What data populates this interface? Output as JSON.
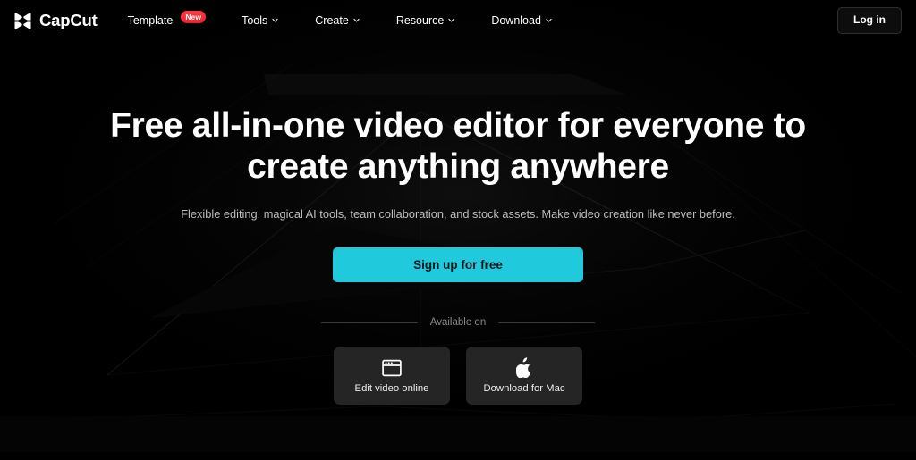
{
  "header": {
    "brand": {
      "name": "CapCut",
      "logo_icon": "capcut-hourglass-logo"
    },
    "nav": [
      {
        "label": "Template",
        "badge": "New",
        "has_chevron": false
      },
      {
        "label": "Tools",
        "badge": null,
        "has_chevron": true
      },
      {
        "label": "Create",
        "badge": null,
        "has_chevron": true
      },
      {
        "label": "Resource",
        "badge": null,
        "has_chevron": true
      },
      {
        "label": "Download",
        "badge": null,
        "has_chevron": true
      }
    ],
    "login_label": "Log in"
  },
  "hero": {
    "title_line1": "Free all-in-one video editor for everyone to",
    "title_line2": "create anything anywhere",
    "subtitle": "Flexible editing, magical AI tools, team collaboration, and stock assets. Make video creation like never before.",
    "cta_label": "Sign up for free"
  },
  "available": {
    "label": "Available on",
    "cards": [
      {
        "label": "Edit video online",
        "icon": "browser-window-icon"
      },
      {
        "label": "Download for Mac",
        "icon": "apple-icon"
      }
    ]
  },
  "colors": {
    "page_background": "#000000",
    "accent_cyan": "#20C9DC",
    "badge_red": "#F5222D",
    "card_background": "#252525",
    "text_primary": "#FFFFFF",
    "text_secondary": "#BDBDBD",
    "text_muted": "#8A8A8A",
    "border_subtle": "#2E2E2E"
  }
}
